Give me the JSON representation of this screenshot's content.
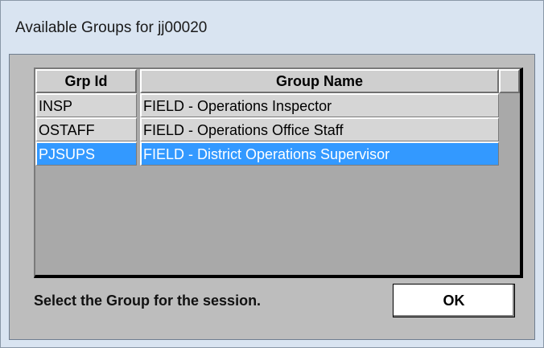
{
  "window": {
    "title": "Available Groups for jj00020"
  },
  "table": {
    "headers": [
      "Grp Id",
      "Group Name"
    ],
    "rows": [
      {
        "id": "INSP",
        "name": "FIELD - Operations Inspector",
        "selected": false
      },
      {
        "id": "OSTAFF",
        "name": "FIELD - Operations Office Staff",
        "selected": false
      },
      {
        "id": "PJSUPS",
        "name": "FIELD - District Operations Supervisor",
        "selected": true
      }
    ]
  },
  "footer": {
    "instruction": "Select the Group for the session.",
    "ok_label": "OK"
  },
  "colors": {
    "selection": "#3399ff",
    "panel": "#bdbdbd",
    "grid_bg": "#a9a9a9"
  }
}
